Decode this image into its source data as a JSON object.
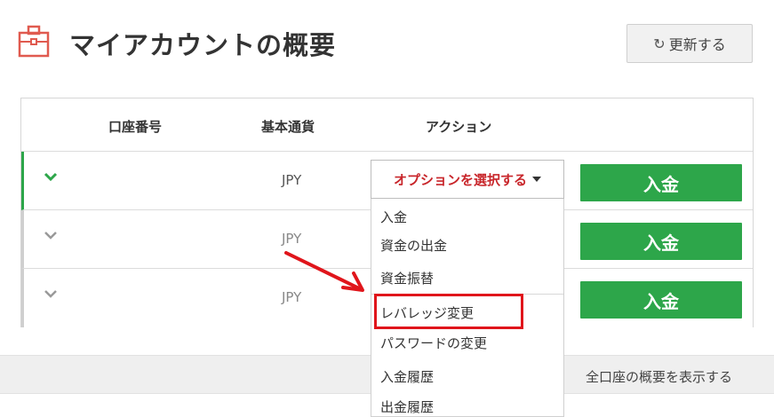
{
  "header": {
    "title": "マイアカウントの概要",
    "refresh_label": "更新する",
    "refresh_icon": "refresh-icon",
    "title_icon": "briefcase-icon"
  },
  "table": {
    "columns": [
      "口座番号",
      "基本通貨",
      "アクション"
    ],
    "rows": [
      {
        "account": "",
        "currency": "JPY",
        "deposit": "入金",
        "expanded": true
      },
      {
        "account": "",
        "currency": "JPY",
        "deposit": "入金",
        "expanded": false
      },
      {
        "account": "",
        "currency": "JPY",
        "deposit": "入金",
        "expanded": false
      }
    ]
  },
  "action_select": {
    "label": "オプションを選択する",
    "options": [
      "入金",
      "資金の出金",
      "資金振替",
      "レバレッジ変更",
      "パスワードの変更",
      "入金履歴",
      "出金履歴"
    ],
    "highlighted": "レバレッジ変更"
  },
  "footer": {
    "link": "全口座の概要を表示する"
  },
  "colors": {
    "accent_green": "#2da64a",
    "accent_red": "#c8262b",
    "highlight_red": "#e0151b",
    "briefcase_red": "#e05a4f"
  }
}
